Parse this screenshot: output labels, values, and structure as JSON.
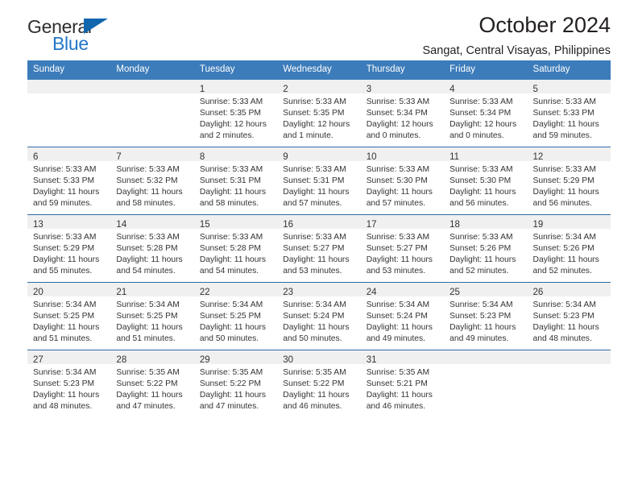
{
  "brand": {
    "name_top": "General",
    "name_bottom": "Blue",
    "triangle_color": "#1266ae",
    "blue_color": "#2277c9",
    "general_color": "#2e2e2e"
  },
  "header": {
    "title": "October 2024",
    "subtitle": "Sangat, Central Visayas, Philippines"
  },
  "theme": {
    "header_bg": "#3c7cba",
    "row_divider": "#2e6da4",
    "date_bar_bg": "#f0f0f0",
    "text": "#333333"
  },
  "calendar": {
    "day_headers": [
      "Sunday",
      "Monday",
      "Tuesday",
      "Wednesday",
      "Thursday",
      "Friday",
      "Saturday"
    ],
    "weeks": [
      [
        {
          "date": "",
          "lines": []
        },
        {
          "date": "",
          "lines": []
        },
        {
          "date": "1",
          "lines": [
            "Sunrise: 5:33 AM",
            "Sunset: 5:35 PM",
            "Daylight: 12 hours",
            "and 2 minutes."
          ]
        },
        {
          "date": "2",
          "lines": [
            "Sunrise: 5:33 AM",
            "Sunset: 5:35 PM",
            "Daylight: 12 hours",
            "and 1 minute."
          ]
        },
        {
          "date": "3",
          "lines": [
            "Sunrise: 5:33 AM",
            "Sunset: 5:34 PM",
            "Daylight: 12 hours",
            "and 0 minutes."
          ]
        },
        {
          "date": "4",
          "lines": [
            "Sunrise: 5:33 AM",
            "Sunset: 5:34 PM",
            "Daylight: 12 hours",
            "and 0 minutes."
          ]
        },
        {
          "date": "5",
          "lines": [
            "Sunrise: 5:33 AM",
            "Sunset: 5:33 PM",
            "Daylight: 11 hours",
            "and 59 minutes."
          ]
        }
      ],
      [
        {
          "date": "6",
          "lines": [
            "Sunrise: 5:33 AM",
            "Sunset: 5:33 PM",
            "Daylight: 11 hours",
            "and 59 minutes."
          ]
        },
        {
          "date": "7",
          "lines": [
            "Sunrise: 5:33 AM",
            "Sunset: 5:32 PM",
            "Daylight: 11 hours",
            "and 58 minutes."
          ]
        },
        {
          "date": "8",
          "lines": [
            "Sunrise: 5:33 AM",
            "Sunset: 5:31 PM",
            "Daylight: 11 hours",
            "and 58 minutes."
          ]
        },
        {
          "date": "9",
          "lines": [
            "Sunrise: 5:33 AM",
            "Sunset: 5:31 PM",
            "Daylight: 11 hours",
            "and 57 minutes."
          ]
        },
        {
          "date": "10",
          "lines": [
            "Sunrise: 5:33 AM",
            "Sunset: 5:30 PM",
            "Daylight: 11 hours",
            "and 57 minutes."
          ]
        },
        {
          "date": "11",
          "lines": [
            "Sunrise: 5:33 AM",
            "Sunset: 5:30 PM",
            "Daylight: 11 hours",
            "and 56 minutes."
          ]
        },
        {
          "date": "12",
          "lines": [
            "Sunrise: 5:33 AM",
            "Sunset: 5:29 PM",
            "Daylight: 11 hours",
            "and 56 minutes."
          ]
        }
      ],
      [
        {
          "date": "13",
          "lines": [
            "Sunrise: 5:33 AM",
            "Sunset: 5:29 PM",
            "Daylight: 11 hours",
            "and 55 minutes."
          ]
        },
        {
          "date": "14",
          "lines": [
            "Sunrise: 5:33 AM",
            "Sunset: 5:28 PM",
            "Daylight: 11 hours",
            "and 54 minutes."
          ]
        },
        {
          "date": "15",
          "lines": [
            "Sunrise: 5:33 AM",
            "Sunset: 5:28 PM",
            "Daylight: 11 hours",
            "and 54 minutes."
          ]
        },
        {
          "date": "16",
          "lines": [
            "Sunrise: 5:33 AM",
            "Sunset: 5:27 PM",
            "Daylight: 11 hours",
            "and 53 minutes."
          ]
        },
        {
          "date": "17",
          "lines": [
            "Sunrise: 5:33 AM",
            "Sunset: 5:27 PM",
            "Daylight: 11 hours",
            "and 53 minutes."
          ]
        },
        {
          "date": "18",
          "lines": [
            "Sunrise: 5:33 AM",
            "Sunset: 5:26 PM",
            "Daylight: 11 hours",
            "and 52 minutes."
          ]
        },
        {
          "date": "19",
          "lines": [
            "Sunrise: 5:34 AM",
            "Sunset: 5:26 PM",
            "Daylight: 11 hours",
            "and 52 minutes."
          ]
        }
      ],
      [
        {
          "date": "20",
          "lines": [
            "Sunrise: 5:34 AM",
            "Sunset: 5:25 PM",
            "Daylight: 11 hours",
            "and 51 minutes."
          ]
        },
        {
          "date": "21",
          "lines": [
            "Sunrise: 5:34 AM",
            "Sunset: 5:25 PM",
            "Daylight: 11 hours",
            "and 51 minutes."
          ]
        },
        {
          "date": "22",
          "lines": [
            "Sunrise: 5:34 AM",
            "Sunset: 5:25 PM",
            "Daylight: 11 hours",
            "and 50 minutes."
          ]
        },
        {
          "date": "23",
          "lines": [
            "Sunrise: 5:34 AM",
            "Sunset: 5:24 PM",
            "Daylight: 11 hours",
            "and 50 minutes."
          ]
        },
        {
          "date": "24",
          "lines": [
            "Sunrise: 5:34 AM",
            "Sunset: 5:24 PM",
            "Daylight: 11 hours",
            "and 49 minutes."
          ]
        },
        {
          "date": "25",
          "lines": [
            "Sunrise: 5:34 AM",
            "Sunset: 5:23 PM",
            "Daylight: 11 hours",
            "and 49 minutes."
          ]
        },
        {
          "date": "26",
          "lines": [
            "Sunrise: 5:34 AM",
            "Sunset: 5:23 PM",
            "Daylight: 11 hours",
            "and 48 minutes."
          ]
        }
      ],
      [
        {
          "date": "27",
          "lines": [
            "Sunrise: 5:34 AM",
            "Sunset: 5:23 PM",
            "Daylight: 11 hours",
            "and 48 minutes."
          ]
        },
        {
          "date": "28",
          "lines": [
            "Sunrise: 5:35 AM",
            "Sunset: 5:22 PM",
            "Daylight: 11 hours",
            "and 47 minutes."
          ]
        },
        {
          "date": "29",
          "lines": [
            "Sunrise: 5:35 AM",
            "Sunset: 5:22 PM",
            "Daylight: 11 hours",
            "and 47 minutes."
          ]
        },
        {
          "date": "30",
          "lines": [
            "Sunrise: 5:35 AM",
            "Sunset: 5:22 PM",
            "Daylight: 11 hours",
            "and 46 minutes."
          ]
        },
        {
          "date": "31",
          "lines": [
            "Sunrise: 5:35 AM",
            "Sunset: 5:21 PM",
            "Daylight: 11 hours",
            "and 46 minutes."
          ]
        },
        {
          "date": "",
          "lines": []
        },
        {
          "date": "",
          "lines": []
        }
      ]
    ]
  }
}
